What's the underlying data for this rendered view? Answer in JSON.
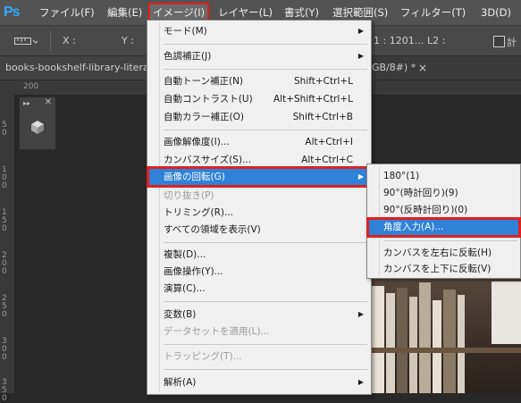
{
  "app": {
    "logo": "Ps"
  },
  "menubar": {
    "items": [
      {
        "label": "ファイル(F)"
      },
      {
        "label": "編集(E)"
      },
      {
        "label": "イメージ(I)"
      },
      {
        "label": "レイヤー(L)"
      },
      {
        "label": "書式(Y)"
      },
      {
        "label": "選択範囲(S)"
      },
      {
        "label": "フィルター(T)"
      },
      {
        "label": "3D(D)"
      }
    ]
  },
  "options_bar": {
    "x_label": "X :",
    "y_label": "Y :",
    "value_fragment": "1 : 1201...",
    "l2_label": "L2 :",
    "checkbox_label": "計"
  },
  "doc_tab": {
    "title": "books-bookshelf-library-litera",
    "mode_fragment": "GB/8#) *",
    "close": "×"
  },
  "ruler": {
    "h_tick": "200",
    "v_ticks": [
      "5 0",
      "1 0 0",
      "1 5 0",
      "2 0 0",
      "2 5 0",
      "3 0 0",
      "3 5 0"
    ]
  },
  "image_menu": {
    "items": [
      {
        "label": "モード(M)",
        "shortcut": "",
        "submenu": true,
        "disabled": false
      },
      {
        "label": "色調補正(J)",
        "shortcut": "",
        "submenu": true,
        "disabled": false
      },
      {
        "label": "自動トーン補正(N)",
        "shortcut": "Shift+Ctrl+L",
        "submenu": false,
        "disabled": false
      },
      {
        "label": "自動コントラスト(U)",
        "shortcut": "Alt+Shift+Ctrl+L",
        "submenu": false,
        "disabled": false
      },
      {
        "label": "自動カラー補正(O)",
        "shortcut": "Shift+Ctrl+B",
        "submenu": false,
        "disabled": false
      },
      {
        "label": "画像解像度(I)...",
        "shortcut": "Alt+Ctrl+I",
        "submenu": false,
        "disabled": false
      },
      {
        "label": "カンバスサイズ(S)...",
        "shortcut": "Alt+Ctrl+C",
        "submenu": false,
        "disabled": false
      },
      {
        "label": "画像の回転(G)",
        "shortcut": "",
        "submenu": true,
        "disabled": false
      },
      {
        "label": "切り抜き(P)",
        "shortcut": "",
        "submenu": false,
        "disabled": true
      },
      {
        "label": "トリミング(R)...",
        "shortcut": "",
        "submenu": false,
        "disabled": false
      },
      {
        "label": "すべての領域を表示(V)",
        "shortcut": "",
        "submenu": false,
        "disabled": false
      },
      {
        "label": "複製(D)...",
        "shortcut": "",
        "submenu": false,
        "disabled": false
      },
      {
        "label": "画像操作(Y)...",
        "shortcut": "",
        "submenu": false,
        "disabled": false
      },
      {
        "label": "演算(C)...",
        "shortcut": "",
        "submenu": false,
        "disabled": false
      },
      {
        "label": "変数(B)",
        "shortcut": "",
        "submenu": true,
        "disabled": false
      },
      {
        "label": "データセットを適用(L)...",
        "shortcut": "",
        "submenu": false,
        "disabled": true
      },
      {
        "label": "トラッピング(T)...",
        "shortcut": "",
        "submenu": false,
        "disabled": true
      },
      {
        "label": "解析(A)",
        "shortcut": "",
        "submenu": true,
        "disabled": false
      }
    ]
  },
  "rotate_submenu": {
    "items": [
      {
        "label": "180°(1)"
      },
      {
        "label": "90°(時計回り)(9)"
      },
      {
        "label": "90°(反時計回り)(0)"
      },
      {
        "label": "角度入力(A)..."
      },
      {
        "label": "カンバスを左右に反転(H)"
      },
      {
        "label": "カンバスを上下に反転(V)"
      }
    ]
  },
  "colors": {
    "highlight": "#2f82d8",
    "annotation_box": "#e02020",
    "menubar_bg": "#535353",
    "menu_bg": "#f0f0f0"
  }
}
